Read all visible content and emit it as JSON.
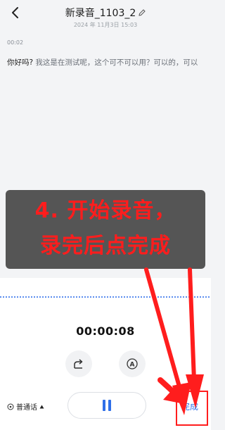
{
  "header": {
    "title": "新录音_1103_2",
    "datetime": "2024 年 11月3日 15:03"
  },
  "transcript": {
    "timestamp": "00:02",
    "lead": "你好吗?",
    "rest": " 我这是在测试呢，这个可不可以用？可以的，可以"
  },
  "overlay": {
    "line1": "4. 开始录音，",
    "line2": "录完后点完成"
  },
  "recorder": {
    "timer": "00:00:08",
    "language": "普通话",
    "done_label": "完成"
  },
  "icons": [
    "back-icon",
    "edit-icon",
    "share-icon",
    "auto-text-icon",
    "language-icon",
    "dropdown-triangle-icon",
    "pause-icon"
  ],
  "colors": {
    "accent": "#2f6fe8",
    "annotation_red": "#ff1d1d",
    "overlay_bg": "#555555"
  }
}
